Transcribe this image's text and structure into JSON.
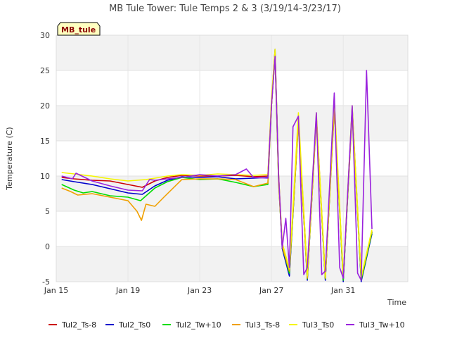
{
  "chart_data": {
    "type": "line",
    "title": "MB Tule Tower: Tule Temps 2 & 3 (3/19/14-3/23/17)",
    "xlabel": "Time",
    "ylabel": "Temperature (C)",
    "badge": "MB_tule",
    "ylim": [
      -5,
      30
    ],
    "yticks": [
      -5,
      0,
      5,
      10,
      15,
      20,
      25,
      30
    ],
    "xlim": [
      0,
      19.6
    ],
    "xticks": [
      {
        "label": "Jan 15",
        "value": 0
      },
      {
        "label": "Jan 19",
        "value": 4
      },
      {
        "label": "Jan 23",
        "value": 8
      },
      {
        "label": "Jan 27",
        "value": 12
      },
      {
        "label": "Jan 31",
        "value": 16
      }
    ],
    "grid": true,
    "legend_position": "bottom",
    "series": [
      {
        "name": "Tul2_Ts-8",
        "color": "#cc0000",
        "x": [
          0.3,
          1.0,
          2.0,
          3.0,
          4.0,
          4.8,
          5.5,
          6.2,
          7.0,
          8.0,
          9.0,
          10.0,
          11.0,
          11.8,
          12.0,
          12.2,
          12.4,
          12.6,
          13.0,
          13.5,
          14.0,
          14.5,
          15.0,
          15.5,
          16.0,
          16.5,
          17.0,
          17.6
        ],
        "y": [
          9.8,
          9.6,
          9.4,
          9.3,
          8.8,
          8.4,
          9.3,
          9.8,
          10.1,
          10.0,
          10.0,
          10.1,
          9.9,
          10.0,
          20.0,
          27.5,
          10.0,
          0.0,
          -3.5,
          18.0,
          -4.0,
          18.5,
          -4.5,
          20.0,
          -4.5,
          19.5,
          -4.5,
          2.0
        ]
      },
      {
        "name": "Tul2_Ts0",
        "color": "#0000cc",
        "x": [
          0.3,
          1.0,
          2.0,
          3.0,
          4.0,
          4.8,
          5.5,
          6.2,
          7.0,
          8.0,
          9.0,
          10.0,
          11.0,
          11.8,
          12.0,
          12.2,
          12.4,
          12.6,
          13.0,
          13.5,
          14.0,
          14.5,
          15.0,
          15.5,
          16.0,
          16.5,
          17.0,
          17.6
        ],
        "y": [
          9.5,
          9.2,
          8.8,
          8.2,
          7.6,
          7.4,
          8.6,
          9.4,
          9.9,
          9.8,
          9.9,
          9.6,
          9.7,
          9.8,
          20.5,
          28.0,
          9.5,
          -0.3,
          -4.2,
          18.0,
          -4.8,
          18.5,
          -4.8,
          20.5,
          -5.0,
          19.8,
          -5.0,
          1.8
        ]
      },
      {
        "name": "Tul2_Tw+10",
        "color": "#00dd00",
        "x": [
          0.3,
          1.0,
          1.5,
          2.0,
          3.0,
          4.0,
          4.7,
          5.5,
          6.2,
          7.0,
          8.0,
          9.0,
          10.0,
          11.0,
          11.8,
          12.0,
          12.2,
          12.4,
          12.6,
          13.0,
          13.5,
          14.0,
          14.5,
          15.0,
          15.5,
          16.0,
          16.5,
          17.0,
          17.6
        ],
        "y": [
          8.8,
          8.0,
          7.6,
          7.8,
          7.2,
          7.0,
          6.5,
          8.3,
          9.2,
          9.8,
          9.5,
          9.6,
          9.1,
          8.5,
          8.8,
          20.0,
          27.0,
          9.0,
          0.0,
          -3.8,
          17.5,
          -4.6,
          18.0,
          -4.6,
          19.5,
          -4.8,
          19.0,
          -4.8,
          2.0
        ]
      },
      {
        "name": "Tul3_Ts-8",
        "color": "#f0a000",
        "x": [
          0.3,
          0.8,
          1.2,
          2.0,
          3.0,
          4.0,
          4.5,
          4.75,
          5.0,
          5.5,
          6.0,
          7.0,
          8.0,
          9.0,
          10.0,
          11.0,
          11.8,
          12.0,
          12.2,
          12.4,
          12.6,
          13.0,
          13.5,
          14.0,
          14.5,
          15.0,
          15.5,
          16.0,
          16.5,
          17.0,
          17.6
        ],
        "y": [
          8.3,
          7.8,
          7.3,
          7.5,
          7.0,
          6.5,
          5.0,
          3.7,
          6.0,
          5.7,
          7.0,
          9.5,
          9.6,
          9.6,
          9.5,
          8.5,
          9.0,
          20.0,
          27.0,
          9.0,
          0.0,
          -3.5,
          17.5,
          -4.5,
          18.0,
          -4.5,
          19.5,
          -4.5,
          19.0,
          -4.5,
          2.2
        ]
      },
      {
        "name": "Tul3_Ts0",
        "color": "#f5f500",
        "x": [
          0.3,
          1.0,
          2.0,
          3.0,
          4.0,
          5.0,
          5.5,
          6.2,
          7.0,
          8.0,
          9.0,
          10.0,
          11.0,
          11.8,
          12.0,
          12.2,
          12.4,
          12.6,
          13.0,
          13.5,
          14.0,
          14.5,
          15.0,
          15.5,
          16.0,
          16.5,
          17.0,
          17.6
        ],
        "y": [
          10.5,
          10.3,
          10.0,
          9.6,
          9.3,
          9.5,
          9.7,
          10.0,
          10.2,
          10.1,
          10.3,
          10.2,
          10.1,
          10.2,
          21.0,
          28.0,
          10.0,
          0.5,
          -3.2,
          19.0,
          -4.2,
          19.0,
          -4.4,
          21.0,
          -4.4,
          20.0,
          -4.4,
          2.4
        ]
      },
      {
        "name": "Tul3_Tw+10",
        "color": "#9a22dd",
        "x": [
          0.3,
          0.9,
          1.1,
          2.0,
          3.0,
          4.0,
          4.8,
          5.2,
          5.5,
          6.2,
          7.0,
          8.0,
          9.0,
          10.0,
          10.6,
          11.0,
          11.8,
          12.0,
          12.2,
          12.4,
          12.6,
          12.8,
          13.0,
          13.2,
          13.5,
          13.8,
          14.0,
          14.5,
          14.8,
          15.0,
          15.5,
          15.8,
          16.0,
          16.5,
          16.8,
          17.0,
          17.3,
          17.6
        ],
        "y": [
          10.0,
          9.6,
          10.4,
          9.3,
          8.6,
          8.0,
          7.9,
          9.5,
          9.4,
          9.6,
          9.8,
          10.2,
          10.0,
          10.2,
          11.0,
          9.8,
          9.7,
          20.0,
          27.0,
          10.0,
          -0.2,
          4.0,
          -3.0,
          17.0,
          18.5,
          -4.0,
          -3.0,
          19.0,
          -4.0,
          -3.5,
          21.8,
          -3.0,
          -4.5,
          20.0,
          -3.8,
          -4.8,
          25.0,
          2.5
        ]
      }
    ]
  }
}
